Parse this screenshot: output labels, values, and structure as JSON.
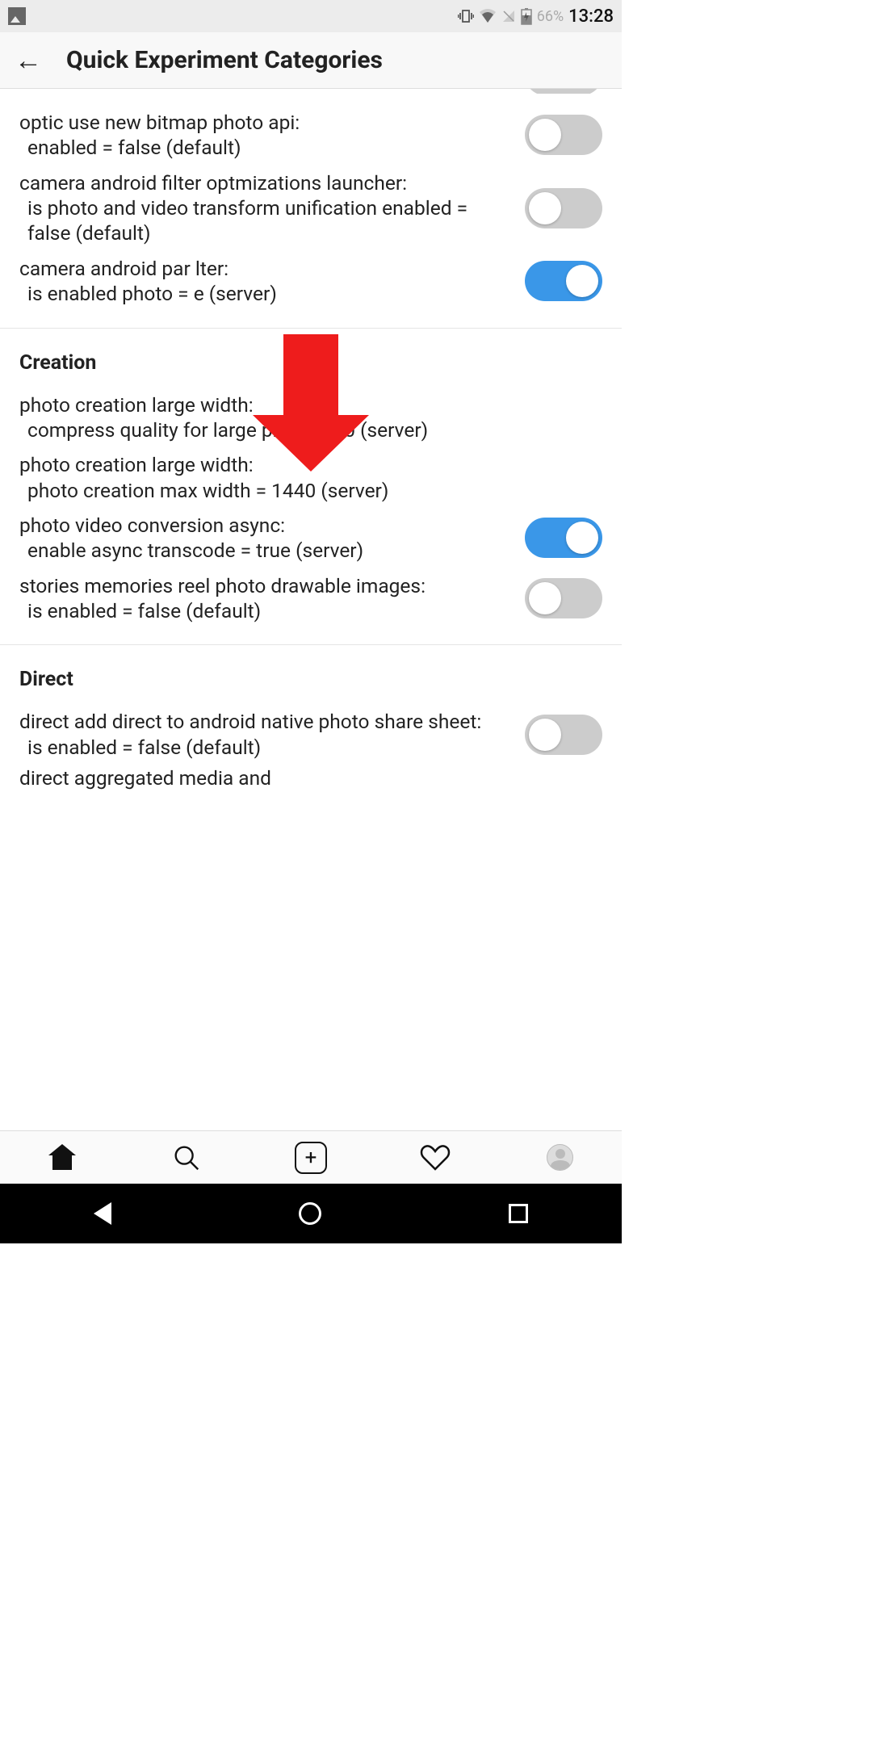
{
  "status": {
    "battery": "66%",
    "time": "13:28"
  },
  "header": {
    "title": "Quick Experiment Categories"
  },
  "rows": [
    {
      "title": "optic use new bitmap photo api:",
      "sub": "enabled = false (default)",
      "toggle": false
    },
    {
      "title": "camera android filter optmizations launcher:",
      "sub": "is photo and video transform unification enabled = false (default)",
      "toggle": false
    },
    {
      "title": "camera android par      lter:",
      "sub": "is enabled photo =       e (server)",
      "toggle": true
    }
  ],
  "section1": "Creation",
  "creation": [
    {
      "title": "photo creation large width:",
      "sub": "compress quality for large photo = 70 (server)",
      "toggle": null
    },
    {
      "title": "photo creation large width:",
      "sub": "photo creation max width = 1440 (server)",
      "toggle": null
    },
    {
      "title": "photo video conversion async:",
      "sub": "enable async transcode = true (server)",
      "toggle": true
    },
    {
      "title": "stories memories reel photo drawable images:",
      "sub": "is enabled = false (default)",
      "toggle": false
    }
  ],
  "section2": "Direct",
  "direct": [
    {
      "title": "direct add direct to android native photo share sheet:",
      "sub": "is enabled = false (default)",
      "toggle": false
    }
  ],
  "cutoff": "direct aggregated media and"
}
